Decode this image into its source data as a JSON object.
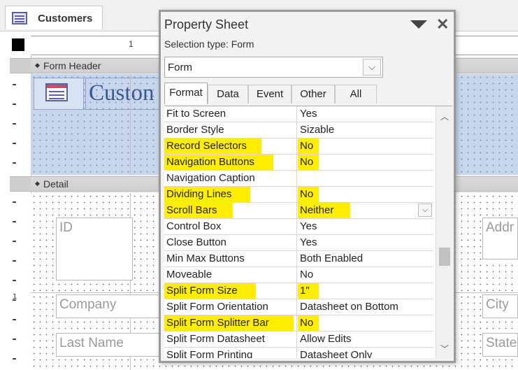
{
  "document_tab": {
    "label": "Customers",
    "icon": "form-icon"
  },
  "ruler": {
    "h_number": "1",
    "v_number": "1"
  },
  "sections": {
    "header_label": "Form Header",
    "detail_label": "Detail"
  },
  "header": {
    "title": "Custon",
    "icon": "form-icon"
  },
  "detail_fields": {
    "id": "ID",
    "address": "Addr",
    "company": "Company",
    "city": "City",
    "last_name": "Last Name",
    "state": "State"
  },
  "property_sheet": {
    "title": "Property Sheet",
    "selection_type": "Selection type:  Form",
    "combo_value": "Form",
    "tabs": [
      {
        "label": "Format",
        "active": true
      },
      {
        "label": "Data",
        "active": false
      },
      {
        "label": "Event",
        "active": false
      },
      {
        "label": "Other",
        "active": false
      },
      {
        "label": "All",
        "active": false
      }
    ],
    "highlight_color": "#ffee00",
    "rows": [
      {
        "name": "Fit to Screen",
        "value": "Yes",
        "highlight": false
      },
      {
        "name": "Border Style",
        "value": "Sizable",
        "highlight": false
      },
      {
        "name": "Record Selectors",
        "value": "No",
        "highlight": true
      },
      {
        "name": "Navigation Buttons",
        "value": "No",
        "highlight": true
      },
      {
        "name": "Navigation Caption",
        "value": "",
        "highlight": false
      },
      {
        "name": "Dividing Lines",
        "value": "No",
        "highlight": true
      },
      {
        "name": "Scroll Bars",
        "value": "Neither",
        "highlight": true,
        "has_dropdown": true
      },
      {
        "name": "Control Box",
        "value": "Yes",
        "highlight": false
      },
      {
        "name": "Close Button",
        "value": "Yes",
        "highlight": false
      },
      {
        "name": "Min Max Buttons",
        "value": "Both Enabled",
        "highlight": false
      },
      {
        "name": "Moveable",
        "value": "No",
        "highlight": false
      },
      {
        "name": "Split Form Size",
        "value": "1\"",
        "highlight": true
      },
      {
        "name": "Split Form Orientation",
        "value": "Datasheet on Bottom",
        "highlight": false
      },
      {
        "name": "Split Form Splitter Bar",
        "value": "No",
        "highlight": true
      },
      {
        "name": "Split Form Datasheet",
        "value": "Allow Edits",
        "highlight": false
      },
      {
        "name": "Split Form Printing",
        "value": "Datasheet Only",
        "highlight": false
      }
    ]
  }
}
